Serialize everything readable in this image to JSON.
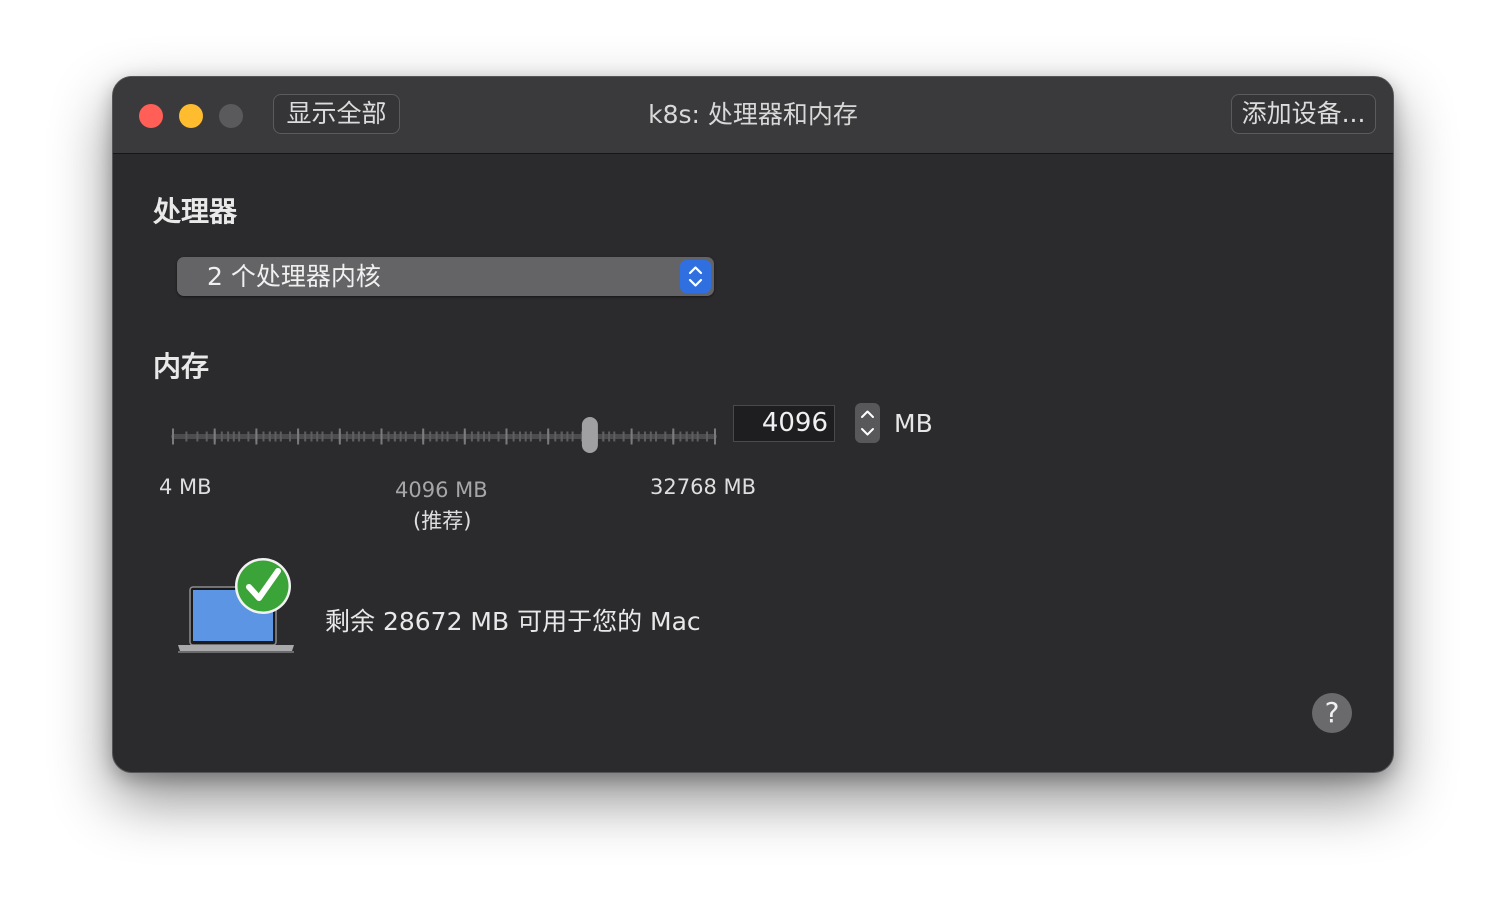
{
  "window": {
    "title": "k8s: 处理器和内存",
    "show_all_label": "显示全部",
    "add_device_label": "添加设备..."
  },
  "processor": {
    "section_title": "处理器",
    "selected": "2 个处理器内核"
  },
  "memory": {
    "section_title": "内存",
    "slider": {
      "min_label": "4 MB",
      "recommended_label": "4096 MB",
      "recommended_note": "(推荐)",
      "max_label": "32768 MB",
      "value_mb": 4096,
      "min_mb": 4,
      "max_mb": 32768
    },
    "value": "4096",
    "unit": "MB"
  },
  "availability": {
    "message": "剩余 28672 MB 可用于您的 Mac"
  },
  "help": {
    "label": "?"
  },
  "colors": {
    "close": "#ff5f57",
    "minimize": "#febc2e",
    "zoom": "#5a5a5d",
    "accent": "#2f6fe0",
    "check": "#3aa438",
    "background": "#2b2b2d"
  }
}
